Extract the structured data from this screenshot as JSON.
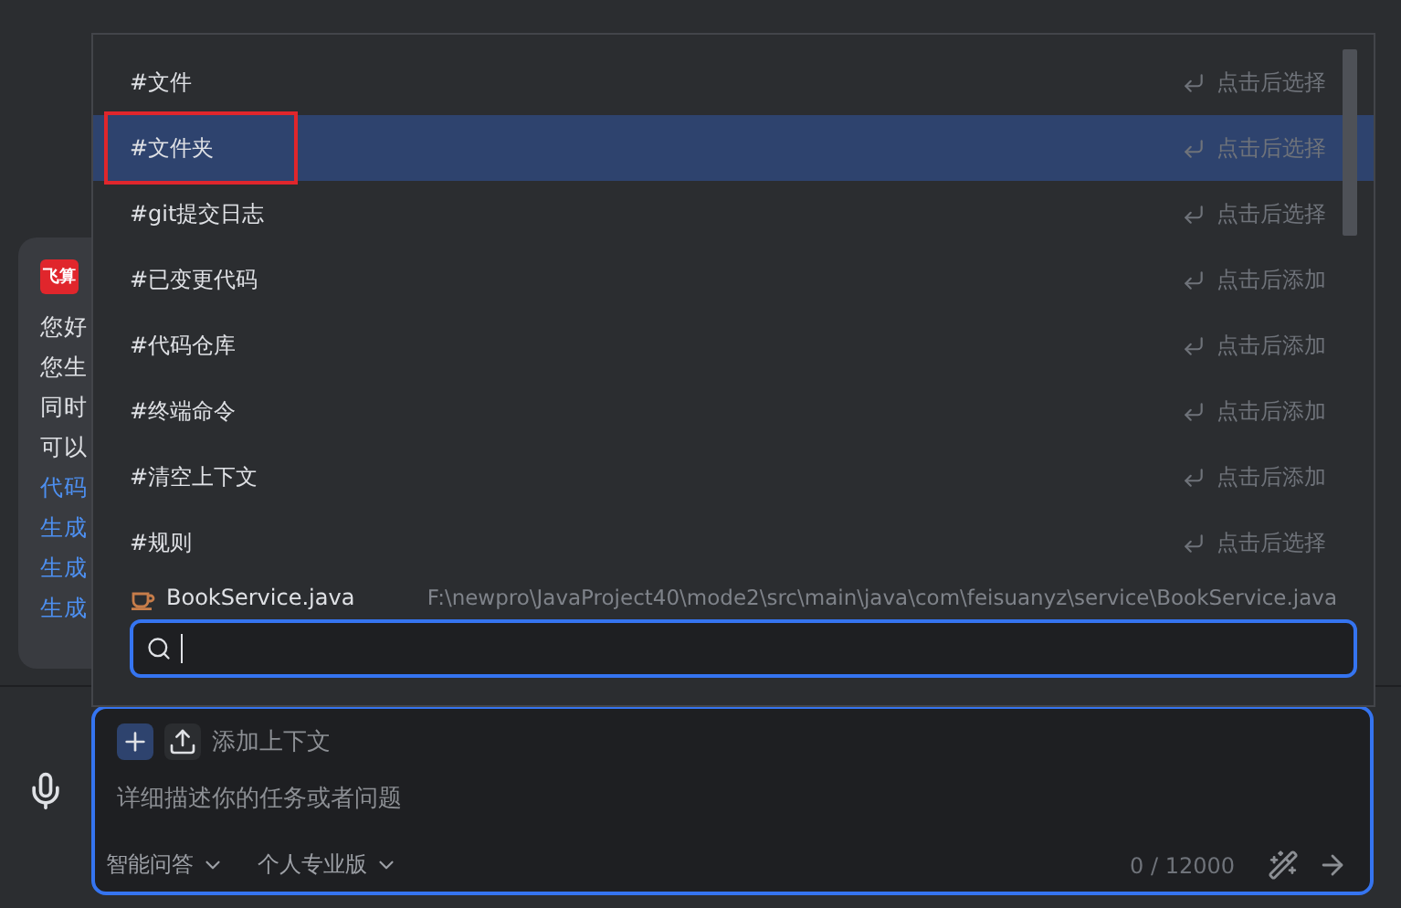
{
  "chat_card": {
    "logo": "飞算",
    "lines": [
      {
        "text": "您好",
        "kind": "plain"
      },
      {
        "text": "您生",
        "kind": "plain"
      },
      {
        "text": "同时",
        "kind": "plain"
      },
      {
        "text": "可以",
        "kind": "plain"
      },
      {
        "text": "代码",
        "kind": "link"
      },
      {
        "text": "生成",
        "kind": "link"
      },
      {
        "text": "生成",
        "kind": "link"
      },
      {
        "text": "生成",
        "kind": "link"
      }
    ]
  },
  "popup": {
    "items": [
      {
        "label": "#文件",
        "hint": "点击后选择",
        "selected": false,
        "highlighted": false
      },
      {
        "label": "#文件夹",
        "hint": "点击后选择",
        "selected": true,
        "highlighted": true
      },
      {
        "label": "#git提交日志",
        "hint": "点击后选择",
        "selected": false,
        "highlighted": false
      },
      {
        "label": "#已变更代码",
        "hint": "点击后添加",
        "selected": false,
        "highlighted": false
      },
      {
        "label": "#代码仓库",
        "hint": "点击后添加",
        "selected": false,
        "highlighted": false
      },
      {
        "label": "#终端命令",
        "hint": "点击后添加",
        "selected": false,
        "highlighted": false
      },
      {
        "label": "#清空上下文",
        "hint": "点击后添加",
        "selected": false,
        "highlighted": false
      },
      {
        "label": "#规则",
        "hint": "点击后选择",
        "selected": false,
        "highlighted": false
      }
    ],
    "file": {
      "name": "BookService.java",
      "path": "F:\\newpro\\JavaProject40\\mode2\\src\\main\\java\\com\\feisuanyz\\service\\BookService.java"
    }
  },
  "composer": {
    "add_context": "添加上下文",
    "placeholder": "详细描述你的任务或者问题",
    "mode": "智能问答",
    "plan": "个人专业版",
    "counter": "0 / 12000"
  }
}
